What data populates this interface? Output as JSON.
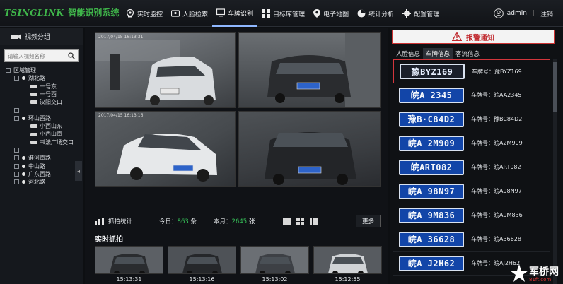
{
  "app": {
    "logo_text": "TSINGLINK",
    "title": "智能识别系统"
  },
  "nav": [
    {
      "label": "实时监控",
      "icon": "monitor-dial-icon"
    },
    {
      "label": "人脸检索",
      "icon": "id-card-icon"
    },
    {
      "label": "车牌识别",
      "icon": "screen-icon",
      "active": true
    },
    {
      "label": "目标库管理",
      "icon": "grid-icon"
    },
    {
      "label": "电子地图",
      "icon": "map-pin-icon"
    },
    {
      "label": "统计分析",
      "icon": "pie-chart-icon"
    },
    {
      "label": "配置管理",
      "icon": "gear-icon"
    }
  ],
  "user": {
    "name": "admin",
    "logout": "注销"
  },
  "sidebar": {
    "title": "视频分组",
    "search_placeholder": "请输入视频名称",
    "tree": [
      {
        "level": 0,
        "type": "box",
        "label": "区域管理"
      },
      {
        "level": 1,
        "type": "dot",
        "label": "湖北路"
      },
      {
        "level": 2,
        "type": "cam",
        "label": "一号东"
      },
      {
        "level": 2,
        "type": "cam",
        "label": "一号西"
      },
      {
        "level": 2,
        "type": "cam",
        "label": "汉阳交口"
      },
      {
        "level": 1,
        "type": "blank",
        "label": ""
      },
      {
        "level": 1,
        "type": "dot",
        "label": "环山西路"
      },
      {
        "level": 2,
        "type": "cam",
        "label": "小西山东"
      },
      {
        "level": 2,
        "type": "cam",
        "label": "小西山南"
      },
      {
        "level": 2,
        "type": "cam",
        "label": "书法广场交口"
      },
      {
        "level": 1,
        "type": "blank",
        "label": ""
      },
      {
        "level": 1,
        "type": "dot",
        "label": "淮河南路"
      },
      {
        "level": 1,
        "type": "dot",
        "label": "中山路"
      },
      {
        "level": 1,
        "type": "dot",
        "label": "广东西路"
      },
      {
        "level": 1,
        "type": "dot",
        "label": "河北路"
      }
    ]
  },
  "video": {
    "tiles": [
      {
        "timestamp": "2017/04/15 16:13:31",
        "plate": "豫YZ169"
      },
      {
        "timestamp": "",
        "plate": "皖AA2345"
      },
      {
        "timestamp": "2017/04/15 16:13:16",
        "plate": "皖BC84D2"
      },
      {
        "timestamp": "",
        "plate": "皖A2M909"
      }
    ]
  },
  "stats": {
    "label": "抓拍统计",
    "today_label": "今日：",
    "today_value": "863",
    "today_unit": "条",
    "month_label": "本月：",
    "month_value": "2645",
    "month_unit": "张",
    "more_button": "更多"
  },
  "live": {
    "title": "实时抓拍",
    "items": [
      {
        "time": "15:13:31"
      },
      {
        "time": "15:13:16"
      },
      {
        "time": "15:13:02"
      },
      {
        "time": "15:12:55"
      }
    ]
  },
  "alarm": {
    "title": "报警通知",
    "tabs": [
      "人脸信息",
      "车牌信息",
      "客流信息"
    ],
    "active_tab": 1,
    "plates": [
      {
        "plate_text": "豫BYZ169",
        "label": "车牌号：豫BYZ169",
        "selected": true
      },
      {
        "plate_text": "皖A 2345",
        "label": "车牌号：皖AA2345"
      },
      {
        "plate_text": "豫B·C84D2",
        "label": "车牌号：豫BC84D2"
      },
      {
        "plate_text": "皖A 2M909",
        "label": "车牌号：皖A2M909"
      },
      {
        "plate_text": "皖ART082",
        "label": "车牌号：皖ART082"
      },
      {
        "plate_text": "皖A 98N97",
        "label": "车牌号：皖A98N97"
      },
      {
        "plate_text": "皖A 9M836",
        "label": "车牌号：皖A9M836"
      },
      {
        "plate_text": "皖A 36628",
        "label": "车牌号：皖A36628"
      },
      {
        "plate_text": "皖A J2H62",
        "label": "车牌号：皖AJ2H62"
      }
    ]
  },
  "watermark": {
    "text": "军桥网",
    "sub": "81ft.com"
  },
  "colors": {
    "accent_green": "#3fb54a",
    "alarm_red": "#c0282d",
    "stat_green": "#37c55a",
    "plate_blue": "#1245a8"
  }
}
